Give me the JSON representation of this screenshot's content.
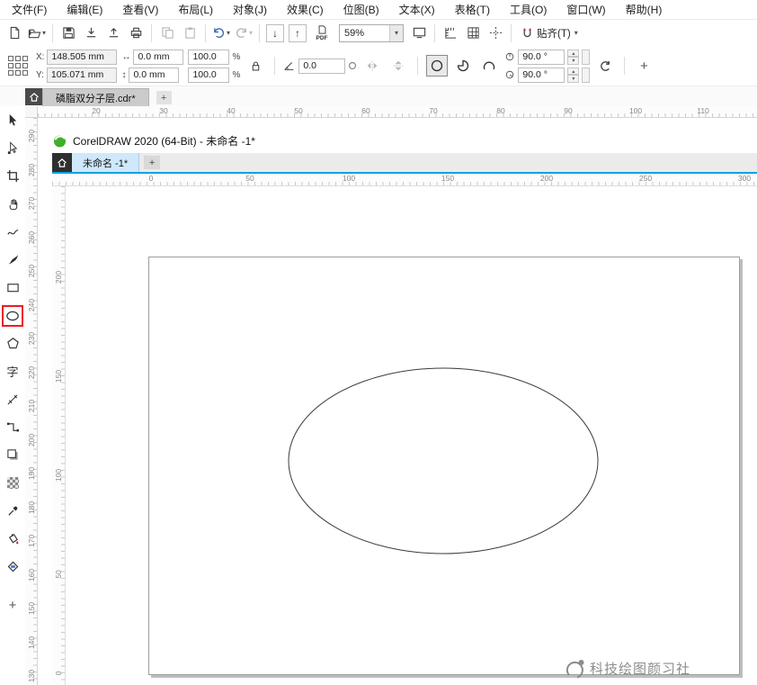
{
  "menu": {
    "items": [
      {
        "label": "文件(F)"
      },
      {
        "label": "编辑(E)"
      },
      {
        "label": "查看(V)"
      },
      {
        "label": "布局(L)"
      },
      {
        "label": "对象(J)"
      },
      {
        "label": "效果(C)"
      },
      {
        "label": "位图(B)"
      },
      {
        "label": "文本(X)"
      },
      {
        "label": "表格(T)"
      },
      {
        "label": "工具(O)"
      },
      {
        "label": "窗口(W)"
      },
      {
        "label": "帮助(H)"
      }
    ]
  },
  "toolbar": {
    "zoom_value": "59%",
    "pdf_label": "PDF",
    "snap_label": "贴齐(T)"
  },
  "property_bar": {
    "x_label": "X:",
    "x_value": "148.505 mm",
    "y_label": "Y:",
    "y_value": "105.071 mm",
    "width_value": "0.0 mm",
    "height_value": "0.0 mm",
    "scale_x_value": "100.0",
    "scale_y_value": "100.0",
    "percent_label": "%",
    "rotation_value": "0.0",
    "angle_start_value": "90.0 °",
    "angle_end_value": "90.0 °"
  },
  "document_tabs": {
    "active_tab_label": "磷脂双分子层.cdr*",
    "new_tab_label": "+"
  },
  "toolbox": {
    "text_tool_label": "字",
    "more_tools_label": "+"
  },
  "outer_ruler": {
    "horizontal": [
      "20",
      "30",
      "40",
      "50",
      "60",
      "70",
      "80",
      "90",
      "100",
      "110"
    ],
    "vertical": [
      "290",
      "280",
      "270",
      "260",
      "250",
      "240",
      "230",
      "220",
      "210",
      "200",
      "190",
      "180",
      "170",
      "160",
      "150",
      "140",
      "130"
    ]
  },
  "inner_window": {
    "title": "CorelDRAW 2020 (64-Bit) - 未命名 -1*",
    "active_tab_label": "未命名 -1*",
    "new_tab_label": "+",
    "ruler_horizontal": [
      "0",
      "50",
      "100",
      "150",
      "200",
      "250",
      "300"
    ],
    "ruler_vertical": [
      "200",
      "150",
      "100",
      "50",
      "0"
    ]
  },
  "watermark": {
    "text": "科技绘图颜习社"
  },
  "colors": {
    "annotation_red": "#ec1c24",
    "inner_tab_blue": "#cfe8fb",
    "divider_cyan": "#00a3e0",
    "logo_green": "#3fae2a"
  }
}
